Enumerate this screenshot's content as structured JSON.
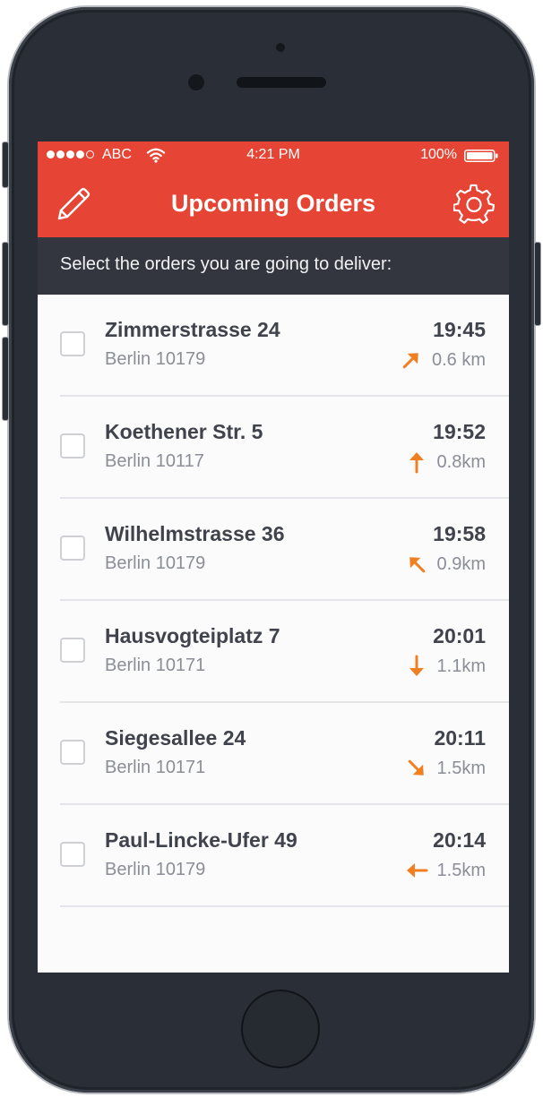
{
  "status_bar": {
    "carrier": "ABC",
    "time": "4:21 PM",
    "battery": "100%"
  },
  "nav": {
    "title": "Upcoming Orders",
    "left_icon": "pencil-icon",
    "right_icon": "gear-icon"
  },
  "subheader": "Select the orders you are going to deliver:",
  "orders": [
    {
      "street": "Zimmerstrasse 24",
      "city": "Berlin 10179",
      "time": "19:45",
      "distance": "0.6 km",
      "direction": "north-east"
    },
    {
      "street": "Koethener Str. 5",
      "city": "Berlin 10117",
      "time": "19:52",
      "distance": "0.8km",
      "direction": "north"
    },
    {
      "street": "Wilhelmstrasse 36",
      "city": "Berlin 10179",
      "time": "19:58",
      "distance": "0.9km",
      "direction": "north-west"
    },
    {
      "street": "Hausvogteiplatz 7",
      "city": "Berlin 10171",
      "time": "20:01",
      "distance": "1.1km",
      "direction": "south"
    },
    {
      "street": "Siegesallee 24",
      "city": "Berlin 10171",
      "time": "20:11",
      "distance": "1.5km",
      "direction": "south-east"
    },
    {
      "street": "Paul-Lincke-Ufer 49",
      "city": "Berlin 10179",
      "time": "20:14",
      "distance": "1.5km",
      "direction": "west"
    }
  ],
  "colors": {
    "accent": "#e64434",
    "subheader_bg": "#33363f",
    "arrow": "#f07f22",
    "phone_body": "#2a2f37"
  }
}
